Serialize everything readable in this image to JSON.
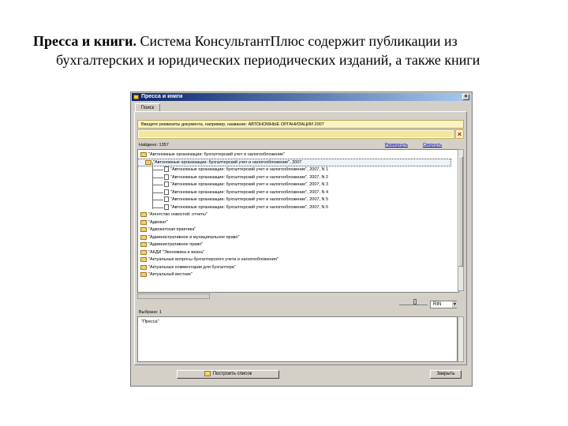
{
  "caption": {
    "bold": "Пресса и книги.",
    "line1": " Система КонсультантПлюс содержит публикации из",
    "line2": "бухгалтерских и юридических периодических изданий, а также книги"
  },
  "window": {
    "title": "Пресса и книги",
    "close_glyph": "×",
    "tab_label": "Поиск",
    "request_hint": "Введите реквизиты документа, например, название: АВТОНОМНЫЕ ОРГАНИЗАЦИИ 2007",
    "clear_glyph": "×",
    "found_label": "Найдено: 1357",
    "link_1": "Развернуть",
    "link_2": "Свернуть",
    "tree": [
      {
        "label": "\"Автономные организации: бухгалтерский учет и налогообложение\"",
        "type": "folder",
        "level": 0
      },
      {
        "label": "\"Автономные организации: бухгалтерский учет и налогообложение\", 2007",
        "type": "folder",
        "level": 1,
        "selected": true
      },
      {
        "label": "\"Автономные организации: бухгалтерский учет и налогообложение\", 2007, N 1",
        "type": "doc",
        "level": 2
      },
      {
        "label": "\"Автономные организации: бухгалтерский учет и налогообложение\", 2007, N 2",
        "type": "doc",
        "level": 2
      },
      {
        "label": "\"Автономные организации: бухгалтерский учет и налогообложение\", 2007, N 3",
        "type": "doc",
        "level": 2
      },
      {
        "label": "\"Автономные организации: бухгалтерский учет и налогообложение\", 2007, N 4",
        "type": "doc",
        "level": 2
      },
      {
        "label": "\"Автономные организации: бухгалтерский учет и налогообложение\", 2007, N 5",
        "type": "doc",
        "level": 2
      },
      {
        "label": "\"Автономные организации: бухгалтерский учет и налогообложение\", 2007, N 6",
        "type": "doc",
        "level": 2
      },
      {
        "label": "\"Агентство новостей: отчеты\"",
        "type": "folder",
        "level": 0
      },
      {
        "label": "\"Адвокат\"",
        "type": "folder",
        "level": 0
      },
      {
        "label": "\"Адвокатская практика\"",
        "type": "folder",
        "level": 0
      },
      {
        "label": "\"Административное и муниципальное право\"",
        "type": "folder",
        "level": 0
      },
      {
        "label": "\"Административное право\"",
        "type": "folder",
        "level": 0
      },
      {
        "label": "\"АКДИ \"Экономика и жизнь\"",
        "type": "folder",
        "level": 0
      },
      {
        "label": "\"Актуальные вопросы бухгалтерского учета и налогообложения\"",
        "type": "folder",
        "level": 0
      },
      {
        "label": "\"Актуальные комментарии для бухгалтера\"",
        "type": "folder",
        "level": 0
      },
      {
        "label": "\"Актуальный вестник\"",
        "type": "folder",
        "level": 0
      }
    ],
    "lang_value": "RIN",
    "lang_arrow": "▼",
    "selected_label": "Выбрано: 1",
    "selected_item": "\"Пресса\"",
    "build_label": "Построить список",
    "close_label": "Закрыть"
  }
}
